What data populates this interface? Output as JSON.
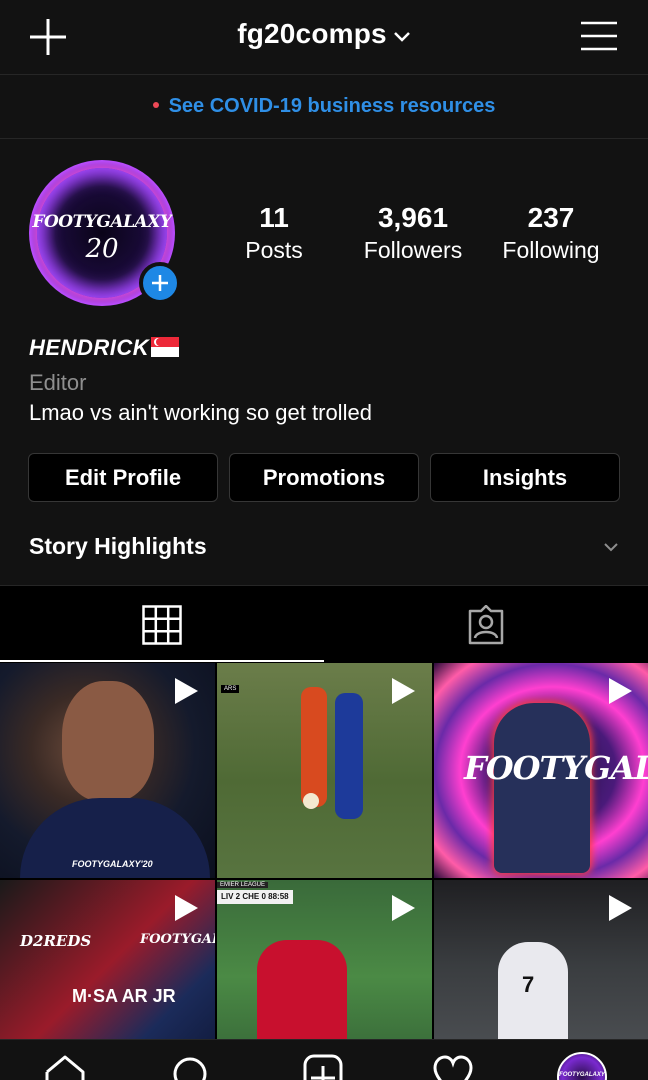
{
  "header": {
    "username": "fg20comps"
  },
  "banner": {
    "text": "See COVID-19 business resources"
  },
  "profile": {
    "avatar_line1": "FOOTYGALAXY",
    "avatar_line2": "20",
    "stats": {
      "posts": {
        "value": "11",
        "label": "Posts"
      },
      "followers": {
        "value": "3,961",
        "label": "Followers"
      },
      "following": {
        "value": "237",
        "label": "Following"
      }
    },
    "display_name": "HENDRICK",
    "category": "Editor",
    "bio": "Lmao vs ain't working so get trolled",
    "buttons": {
      "edit": "Edit Profile",
      "promotions": "Promotions",
      "insights": "Insights"
    },
    "highlights_label": "Story Highlights"
  },
  "posts": [
    {
      "overlay": "FOOTYGALAXY'20",
      "is_video": true
    },
    {
      "overlay": "ARS",
      "is_video": true
    },
    {
      "overlay": "FOOTYGALAXY",
      "is_video": true
    },
    {
      "overlay_left": "D2REDS",
      "overlay_right": "FOOTYGALAXY",
      "overlay_mid": "M·SA AR JR",
      "is_video": true
    },
    {
      "league": "EMIER LEAGUE",
      "score": "LIV 2 CHE 0 88:58",
      "is_video": true
    },
    {
      "number": "7",
      "is_video": true
    }
  ],
  "colors": {
    "background": "#000000",
    "surface": "#121212",
    "link_blue": "#2f8fe6",
    "badge_blue": "#1e88e5",
    "dot_red": "#ed4956",
    "muted_text": "#8e8e8e"
  },
  "icons": {
    "top_left": "plus-icon",
    "top_right": "hamburger-menu-icon",
    "tabs": [
      "grid-icon",
      "tagged-person-icon"
    ],
    "bottom_nav": [
      "home-icon",
      "search-icon",
      "add-post-icon",
      "heart-icon",
      "profile-avatar"
    ]
  }
}
